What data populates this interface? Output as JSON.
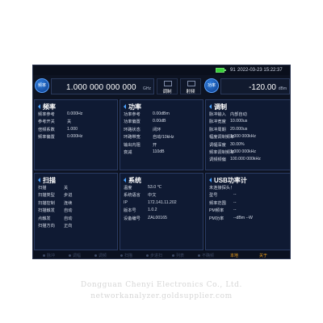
{
  "status": {
    "battery_count": "91",
    "datetime": "2022-03-23 15:22:37"
  },
  "colors": {
    "accent": "#4da3ff",
    "active_nav": "#f3a21b",
    "battery": "#37d137",
    "background": "#0d1322"
  },
  "main": {
    "freq_button": "频率",
    "freq_value": "1.000 000 000 000",
    "freq_unit": "GHz",
    "mod_button": "调制",
    "rf_button": "射频",
    "power_button": "功率",
    "power_value": "-120.00",
    "power_unit": "dBm"
  },
  "panels": {
    "freq": {
      "title": "频率",
      "rows": [
        {
          "k": "频率参考",
          "v": "0.000Hz"
        },
        {
          "k": "参考开关",
          "v": "关"
        },
        {
          "k": "倍频系数",
          "v": "1.000"
        },
        {
          "k": "频率偏置",
          "v": "0.000Hz"
        }
      ]
    },
    "power": {
      "title": "功率",
      "rows": [
        {
          "k": "功率参考",
          "v": "0.00dBm"
        },
        {
          "k": "功率偏置",
          "v": "0.00dB"
        },
        {
          "k": "环路状态",
          "v": "闭环"
        },
        {
          "k": "环路带宽",
          "v": "自动/10kHz"
        },
        {
          "k": "输出内阻",
          "v": "开"
        },
        {
          "k": "衰减",
          "v": "110dB"
        }
      ]
    },
    "mod": {
      "title": "调制",
      "rows": [
        {
          "k": "脉冲输入",
          "v": "内部自动"
        },
        {
          "k": "脉冲宽度",
          "v": "10.000us"
        },
        {
          "k": "脉冲周期",
          "v": "20.000us"
        },
        {
          "k": "幅度调制频率",
          "v": "1.000 000kHz"
        },
        {
          "k": "调幅深度",
          "v": "30.00%"
        },
        {
          "k": "频率调制频率",
          "v": "1.000 000kHz"
        },
        {
          "k": "调频频偏",
          "v": "100.000 000kHz"
        }
      ]
    },
    "sweep": {
      "title": "扫描",
      "rows": [
        {
          "k": "扫描",
          "v": "关"
        },
        {
          "k": "扫描类型",
          "v": "步进"
        },
        {
          "k": "扫描控制",
          "v": "连续"
        },
        {
          "k": "扫描触发",
          "v": "自动"
        },
        {
          "k": "点触发",
          "v": "自动"
        },
        {
          "k": "扫描方向",
          "v": "正向"
        }
      ]
    },
    "system": {
      "title": "系统",
      "rows": [
        {
          "k": "温度",
          "v": "53.0 ℃"
        },
        {
          "k": "系统语言",
          "v": "中文"
        },
        {
          "k": "IP",
          "v": "172.141.11.202"
        },
        {
          "k": "版本号",
          "v": "1.0.2"
        },
        {
          "k": "设备编号",
          "v": "ZAL00165"
        }
      ]
    },
    "usb": {
      "title": "USB功率计",
      "rows": [
        {
          "k": "未连接探头！",
          "v": ""
        },
        {
          "k": "型号",
          "v": "--"
        },
        {
          "k": "频率范围",
          "v": "--"
        },
        {
          "k": "PM频率",
          "v": "--"
        },
        {
          "k": "PM功率",
          "v": "--dBm --W"
        }
      ]
    }
  },
  "nav": [
    {
      "label": "脉冲",
      "active": false
    },
    {
      "label": "调幅",
      "active": false
    },
    {
      "label": "调频",
      "active": false
    },
    {
      "label": "扫描",
      "active": false
    },
    {
      "label": "步进扫",
      "active": false
    },
    {
      "label": "列表",
      "active": false
    },
    {
      "label": "不确频",
      "active": false
    },
    {
      "label": "本地",
      "active": true
    },
    {
      "label": "关于",
      "active": true
    }
  ],
  "watermark": {
    "line1": "Dongguan Chenyi Electronics Co., Ltd.",
    "line2": "networkanalyzer.goldsupplier.com"
  }
}
